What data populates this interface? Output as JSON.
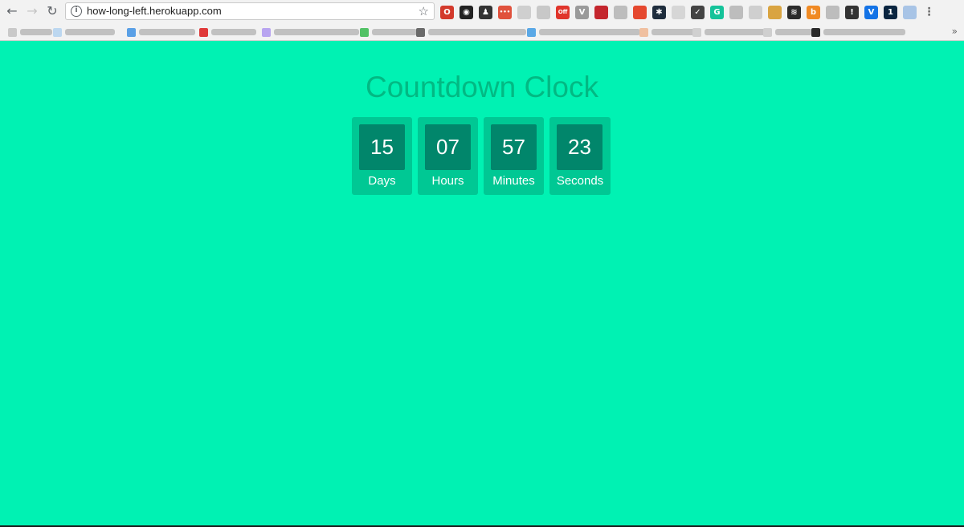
{
  "browser": {
    "url": "how-long-left.herokuapp.com",
    "icons": {
      "back": "back-arrow-icon",
      "forward": "forward-arrow-icon",
      "reload": "reload-icon",
      "info": "info-icon",
      "star": "bookmark-star-icon"
    },
    "extensions": [
      {
        "name": "opera-extension-icon",
        "color": "#d33a2c",
        "glyph": "O"
      },
      {
        "name": "eye-extension-icon",
        "color": "#222222",
        "glyph": "◉"
      },
      {
        "name": "microscope-extension-icon",
        "color": "#333333",
        "glyph": "♟"
      },
      {
        "name": "red-dots-extension-icon",
        "color": "#e0513c",
        "glyph": "•••"
      },
      {
        "name": "grey-circle-extension-icon",
        "color": "#cfcfcf",
        "glyph": ""
      },
      {
        "name": "doc-extension-icon",
        "color": "#c8c8c8",
        "glyph": ""
      },
      {
        "name": "off-badge-extension-icon",
        "color": "#e0352b",
        "glyph": "Off"
      },
      {
        "name": "vee-extension-icon",
        "color": "#9a9a9a",
        "glyph": "V"
      },
      {
        "name": "red-box-extension-icon",
        "color": "#c4262d",
        "glyph": ""
      },
      {
        "name": "bird-extension-icon",
        "color": "#bdbdbd",
        "glyph": ""
      },
      {
        "name": "speech-extension-icon",
        "color": "#e5482f",
        "glyph": ""
      },
      {
        "name": "spark-extension-icon",
        "color": "#1f2d3d",
        "glyph": "✱"
      },
      {
        "name": "circle-outline-extension-icon",
        "color": "#d6d6d6",
        "glyph": ""
      },
      {
        "name": "pocket-extension-icon",
        "color": "#444444",
        "glyph": "✓"
      },
      {
        "name": "grammarly-extension-icon",
        "color": "#15c39a",
        "glyph": "G"
      },
      {
        "name": "mountain-extension-icon",
        "color": "#bdbdbd",
        "glyph": ""
      },
      {
        "name": "magnifier-extension-icon",
        "color": "#cfcfcf",
        "glyph": ""
      },
      {
        "name": "photo-extension-icon",
        "color": "#d9a441",
        "glyph": ""
      },
      {
        "name": "layers-extension-icon",
        "color": "#2b2b2b",
        "glyph": "≋"
      },
      {
        "name": "orange-b-extension-icon",
        "color": "#f08a24",
        "glyph": "b"
      },
      {
        "name": "person-extension-icon",
        "color": "#bdbdbd",
        "glyph": ""
      },
      {
        "name": "one-info-extension-icon",
        "color": "#333333",
        "glyph": "!"
      },
      {
        "name": "v-blue-extension-icon",
        "color": "#1473e6",
        "glyph": "V"
      },
      {
        "name": "one-password-extension-icon",
        "color": "#0a2540",
        "glyph": "1"
      },
      {
        "name": "dropbox-extension-icon",
        "color": "#a8c4e6",
        "glyph": ""
      },
      {
        "name": "kebab-menu-icon",
        "color": "#6a6a6a",
        "glyph": "⋮"
      }
    ],
    "bookmarks_overflow": "»"
  },
  "page": {
    "title": "Countdown Clock",
    "colors": {
      "background": "#00f2b3",
      "title": "#02b983",
      "unit_bg": "#00c894",
      "number_bg": "#01866b"
    }
  },
  "countdown": {
    "days": {
      "value": "15",
      "label": "Days"
    },
    "hours": {
      "value": "07",
      "label": "Hours"
    },
    "minutes": {
      "value": "57",
      "label": "Minutes"
    },
    "seconds": {
      "value": "23",
      "label": "Seconds"
    }
  }
}
